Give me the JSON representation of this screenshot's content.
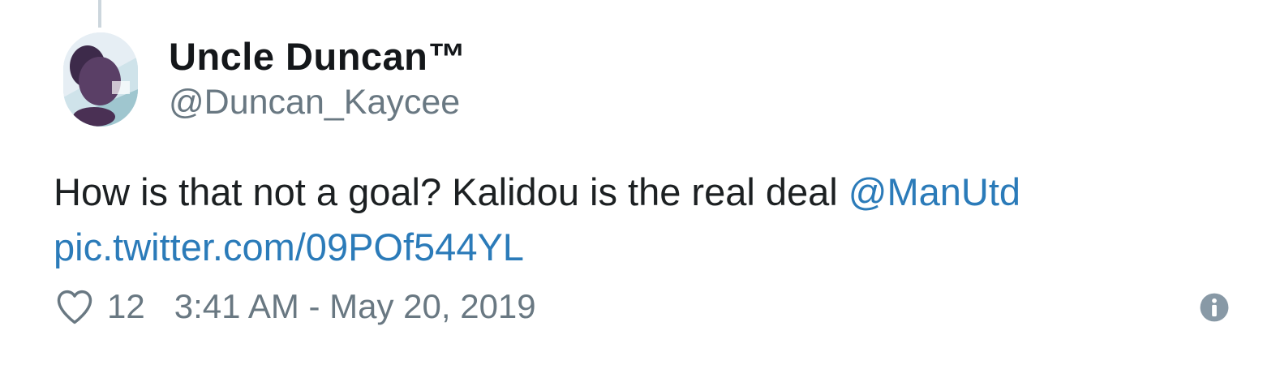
{
  "tweet": {
    "display_name": "Uncle Duncan™",
    "handle": "@Duncan_Kaycee",
    "text_main": "How is that not a goal? Kalidou is the real deal ",
    "mention": "@ManUtd",
    "pic_link": "pic.twitter.com/09POf544YL",
    "like_count": "12",
    "timestamp": "3:41 AM - May 20, 2019"
  },
  "icons": {
    "like": "heart-icon",
    "info": "info-icon"
  },
  "colors": {
    "link": "#2b7bb9",
    "muted": "#697882",
    "text": "#1c2022"
  }
}
